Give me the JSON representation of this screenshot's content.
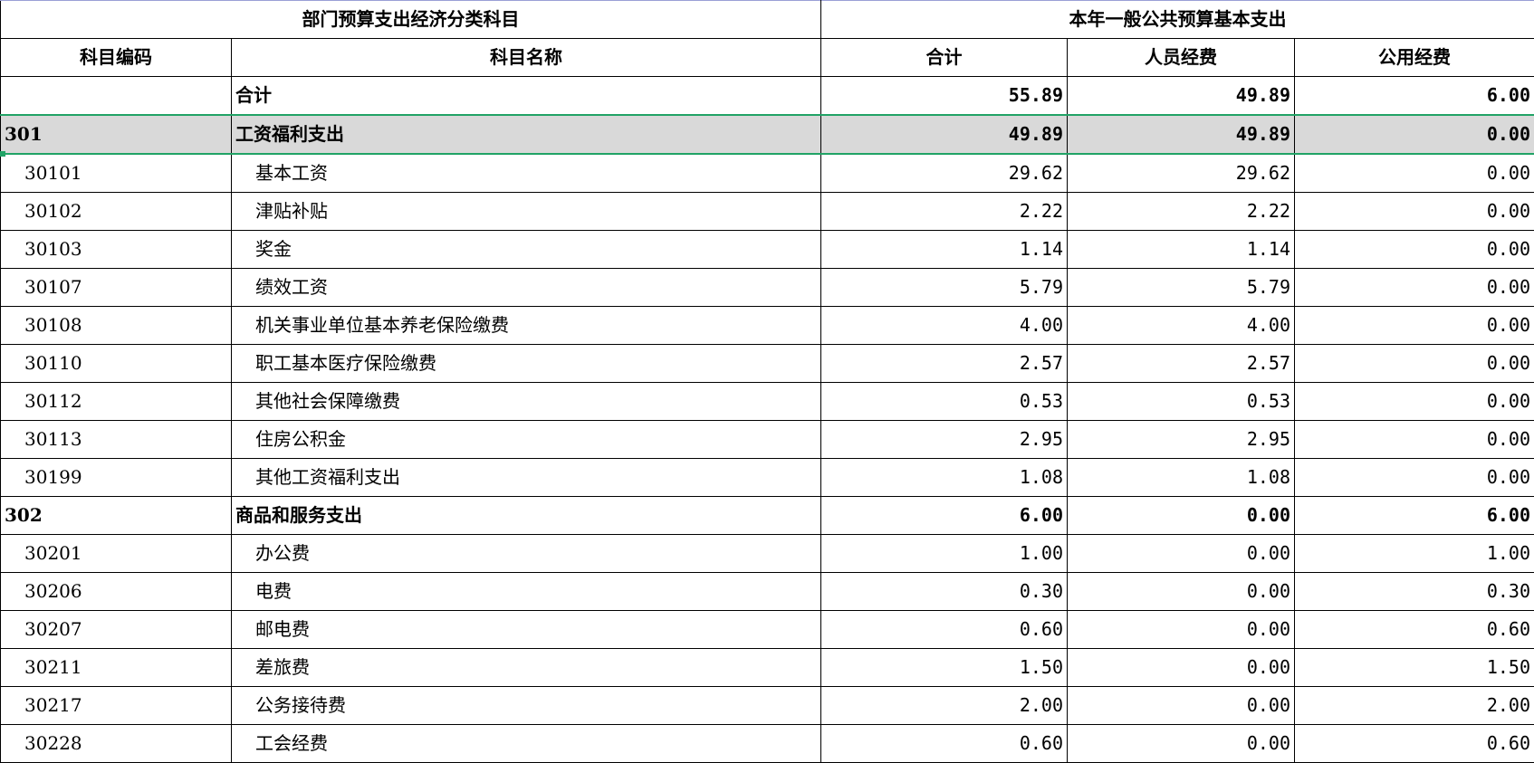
{
  "header": {
    "group_left": "部门预算支出经济分类科目",
    "group_right": "本年一般公共预算基本支出",
    "col_code": "科目编码",
    "col_name": "科目名称",
    "col_total": "合计",
    "col_personnel": "人员经费",
    "col_public": "公用经费"
  },
  "rows": [
    {
      "code": "",
      "name": "合计",
      "total": "55.89",
      "personnel": "49.89",
      "public": "6.00",
      "level": "total"
    },
    {
      "code": "301",
      "name": "工资福利支出",
      "total": "49.89",
      "personnel": "49.89",
      "public": "0.00",
      "level": "category",
      "selected": true
    },
    {
      "code": "30101",
      "name": "基本工资",
      "total": "29.62",
      "personnel": "29.62",
      "public": "0.00",
      "level": "item"
    },
    {
      "code": "30102",
      "name": "津贴补贴",
      "total": "2.22",
      "personnel": "2.22",
      "public": "0.00",
      "level": "item"
    },
    {
      "code": "30103",
      "name": "奖金",
      "total": "1.14",
      "personnel": "1.14",
      "public": "0.00",
      "level": "item"
    },
    {
      "code": "30107",
      "name": "绩效工资",
      "total": "5.79",
      "personnel": "5.79",
      "public": "0.00",
      "level": "item"
    },
    {
      "code": "30108",
      "name": "机关事业单位基本养老保险缴费",
      "total": "4.00",
      "personnel": "4.00",
      "public": "0.00",
      "level": "item"
    },
    {
      "code": "30110",
      "name": "职工基本医疗保险缴费",
      "total": "2.57",
      "personnel": "2.57",
      "public": "0.00",
      "level": "item"
    },
    {
      "code": "30112",
      "name": "其他社会保障缴费",
      "total": "0.53",
      "personnel": "0.53",
      "public": "0.00",
      "level": "item"
    },
    {
      "code": "30113",
      "name": "住房公积金",
      "total": "2.95",
      "personnel": "2.95",
      "public": "0.00",
      "level": "item"
    },
    {
      "code": "30199",
      "name": "其他工资福利支出",
      "total": "1.08",
      "personnel": "1.08",
      "public": "0.00",
      "level": "item"
    },
    {
      "code": "302",
      "name": "商品和服务支出",
      "total": "6.00",
      "personnel": "0.00",
      "public": "6.00",
      "level": "category"
    },
    {
      "code": "30201",
      "name": "办公费",
      "total": "1.00",
      "personnel": "0.00",
      "public": "1.00",
      "level": "item"
    },
    {
      "code": "30206",
      "name": "电费",
      "total": "0.30",
      "personnel": "0.00",
      "public": "0.30",
      "level": "item"
    },
    {
      "code": "30207",
      "name": "邮电费",
      "total": "0.60",
      "personnel": "0.00",
      "public": "0.60",
      "level": "item"
    },
    {
      "code": "30211",
      "name": "差旅费",
      "total": "1.50",
      "personnel": "0.00",
      "public": "1.50",
      "level": "item"
    },
    {
      "code": "30217",
      "name": "公务接待费",
      "total": "2.00",
      "personnel": "0.00",
      "public": "2.00",
      "level": "item"
    },
    {
      "code": "30228",
      "name": "工会经费",
      "total": "0.60",
      "personnel": "0.00",
      "public": "0.60",
      "level": "item"
    }
  ],
  "colors": {
    "selection_border": "#21a366",
    "selection_fill": "#d9d9d9",
    "grid_line": "#000000"
  }
}
